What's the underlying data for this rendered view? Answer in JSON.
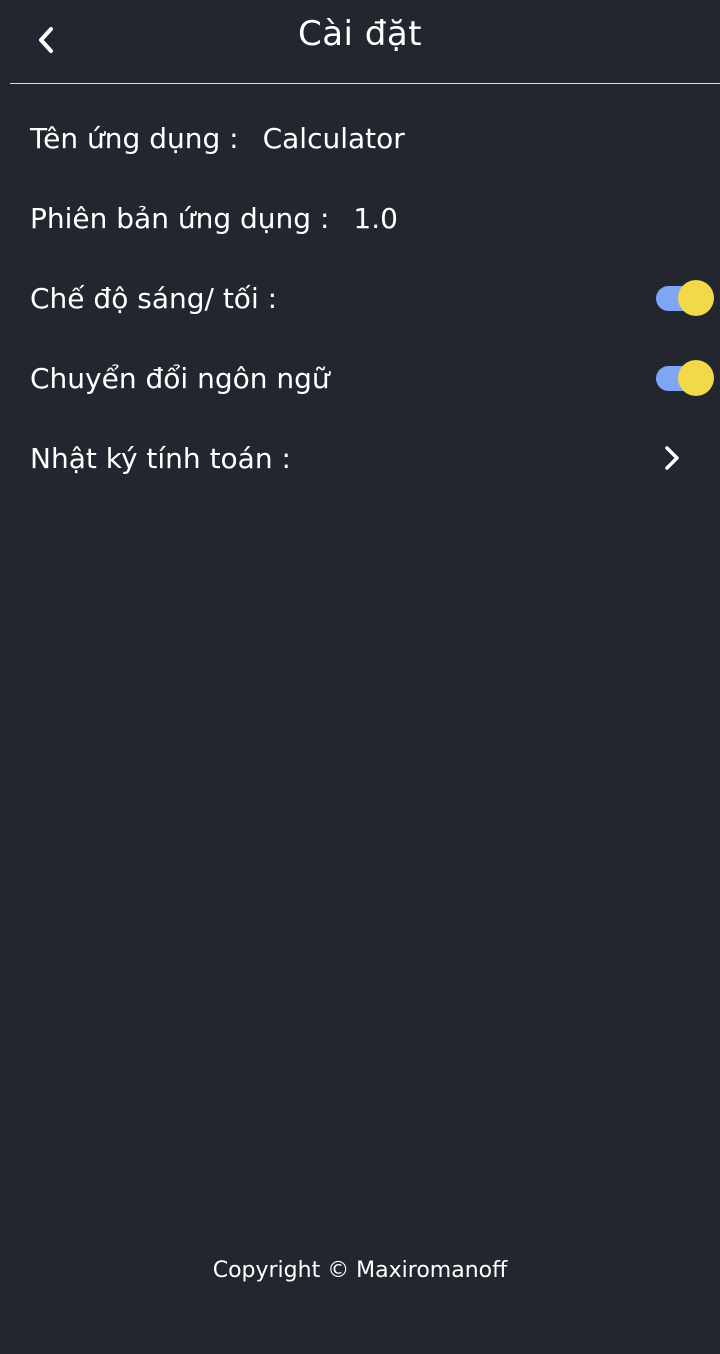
{
  "header": {
    "title": "Cài đặt",
    "back_icon": "chevron-left-icon"
  },
  "settings": {
    "app_name": {
      "label": "Tên ứng dụng :",
      "value": "Calculator"
    },
    "app_version": {
      "label": "Phiên bản ứng dụng :",
      "value": "1.0"
    },
    "theme_mode": {
      "label": "Chế độ sáng/ tối :",
      "enabled": true
    },
    "language_switch": {
      "label": "Chuyển đổi ngôn ngữ",
      "enabled": true
    },
    "calc_history": {
      "label": "Nhật ký tính toán :",
      "icon": "chevron-right-icon"
    }
  },
  "footer": {
    "copyright": "Copyright © Maxiromanoff"
  },
  "colors": {
    "background": "#23262f",
    "toggle_track": "#7fa6f4",
    "toggle_knob": "#f2d94a",
    "divider": "#d9d9d9"
  }
}
